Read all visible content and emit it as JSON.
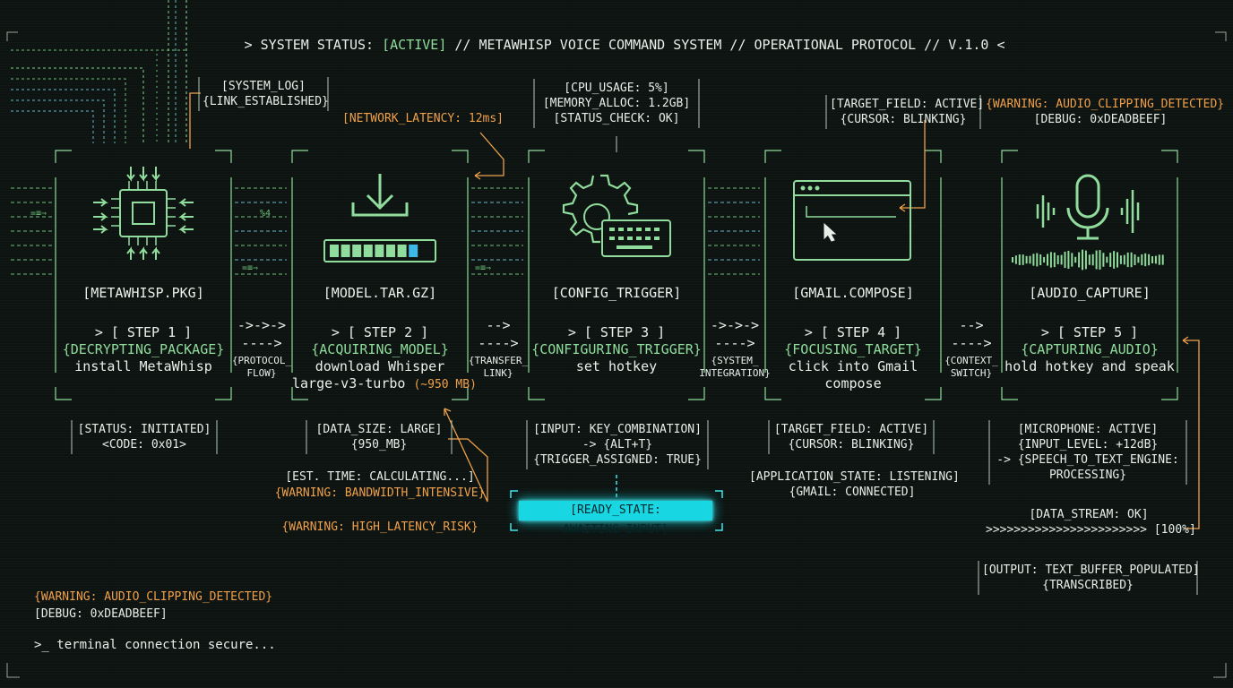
{
  "header": {
    "prefix": "> SYSTEM STATUS: ",
    "active": "[ACTIVE]",
    "rest": " // METAWHISP VOICE COMMAND SYSTEM // OPERATIONAL PROTOCOL // V.1.0 <"
  },
  "colors": {
    "green": "#8fdc9c",
    "orange": "#f0a04a",
    "cyan": "#3ce6ef",
    "white": "#e7efe9",
    "bg": "#0c1310"
  },
  "cards": [
    {
      "icon": "cpu-chip-icon",
      "filename": "[METAWHISP.PKG]",
      "step": "> [ STEP 1 ]",
      "state": "{DECRYPTING_PACKAGE}",
      "desc1": "install MetaWhisp",
      "desc2": "",
      "desc2_extra": ""
    },
    {
      "icon": "download-icon",
      "filename": "[MODEL.TAR.GZ]",
      "step": "> [ STEP 2 ]",
      "state": "{ACQUIRING_MODEL}",
      "desc1": "download Whisper",
      "desc2": "large-v3-turbo ",
      "desc2_extra": "(~950 MB)"
    },
    {
      "icon": "gear-keyboard-icon",
      "filename": "[CONFIG_TRIGGER]",
      "step": "> [ STEP 3 ]",
      "state": "{CONFIGURING_TRIGGER}",
      "desc1": "set hotkey",
      "desc2": "",
      "desc2_extra": ""
    },
    {
      "icon": "browser-window-icon",
      "filename": "[GMAIL.COMPOSE]",
      "step": "> [ STEP 4 ]",
      "state": "{FOCUSING_TARGET}",
      "desc1": "click into Gmail",
      "desc2": "compose",
      "desc2_extra": ""
    },
    {
      "icon": "microphone-icon",
      "filename": "[AUDIO_CAPTURE]",
      "step": "> [ STEP 5 ]",
      "state": "{CAPTURING_AUDIO}",
      "desc1": "hold hotkey and speak",
      "desc2": "",
      "desc2_extra": ""
    }
  ],
  "connectors": [
    {
      "arrow1": "->->->",
      "arrow2": "---->",
      "label1": "{PROTOCOL_",
      "label2": "FLOW}"
    },
    {
      "arrow1": "-->",
      "arrow2": "---->",
      "label1": "{TRANSFER_",
      "label2": "LINK}"
    },
    {
      "arrow1": "->->->",
      "arrow2": "---->",
      "label1": "{SYSTEM_",
      "label2": "INTEGRATION}"
    },
    {
      "arrow1": "-->",
      "arrow2": "---->",
      "label1": "{CONTEXT_",
      "label2": "SWITCH}"
    }
  ],
  "top_notes": {
    "system_log": [
      "[SYSTEM_LOG]",
      "{LINK_ESTABLISHED}"
    ],
    "network": "[NETWORK_LATENCY: 12ms]",
    "resources": [
      "[CPU_USAGE: 5%]",
      "[MEMORY_ALLOC: 1.2GB]",
      "[STATUS_CHECK: OK]"
    ],
    "target": [
      "[TARGET_FIELD: ACTIVE]",
      "{CURSOR: BLINKING}"
    ],
    "warning": "{WARNING: AUDIO_CLIPPING_DETECTED}",
    "debug": "[DEBUG: 0xDEADBEEF]"
  },
  "bottom_notes": {
    "s1": [
      "[STATUS: INITIATED]",
      "<CODE: 0x01>"
    ],
    "s2": [
      "[DATA_SIZE: LARGE]",
      "{950_MB}"
    ],
    "s2_est": "[EST. TIME: CALCULATING...]",
    "s2_warn1": "{WARNING: BANDWIDTH_INTENSIVE}",
    "s2_warn2": "{WARNING: HIGH_LATENCY_RISK}",
    "s3": [
      "[INPUT: KEY_COMBINATION]",
      "-> {ALT+T}",
      "{TRIGGER_ASSIGNED: TRUE}"
    ],
    "s3_ready": "[READY_STATE: AWAITING_INPUT]",
    "s4": [
      "[TARGET_FIELD: ACTIVE]",
      "{CURSOR: BLINKING}"
    ],
    "s4_app": [
      "[APPLICATION_STATE: LISTENING]",
      "{GMAIL: CONNECTED]"
    ],
    "s5": [
      "[MICROPHONE: ACTIVE]",
      "{INPUT_LEVEL: +12dB}",
      "-> {SPEECH_TO_TEXT_ENGINE:",
      "PROCESSING}"
    ],
    "s5_stream": [
      "[DATA_STREAM: OK]",
      ">>>>>>>>>>>>>>>>>>>>>>> [100%]"
    ],
    "s5_output": [
      "[OUTPUT: TEXT_BUFFER_POPULATED]",
      "{TRANSCRIBED}"
    ]
  },
  "footer": {
    "warning": "{WARNING: AUDIO_CLIPPING_DETECTED}",
    "debug": "[DEBUG: 0xDEADBEEF]",
    "terminal": ">_ terminal connection secure..."
  },
  "download_progress": 0.85
}
